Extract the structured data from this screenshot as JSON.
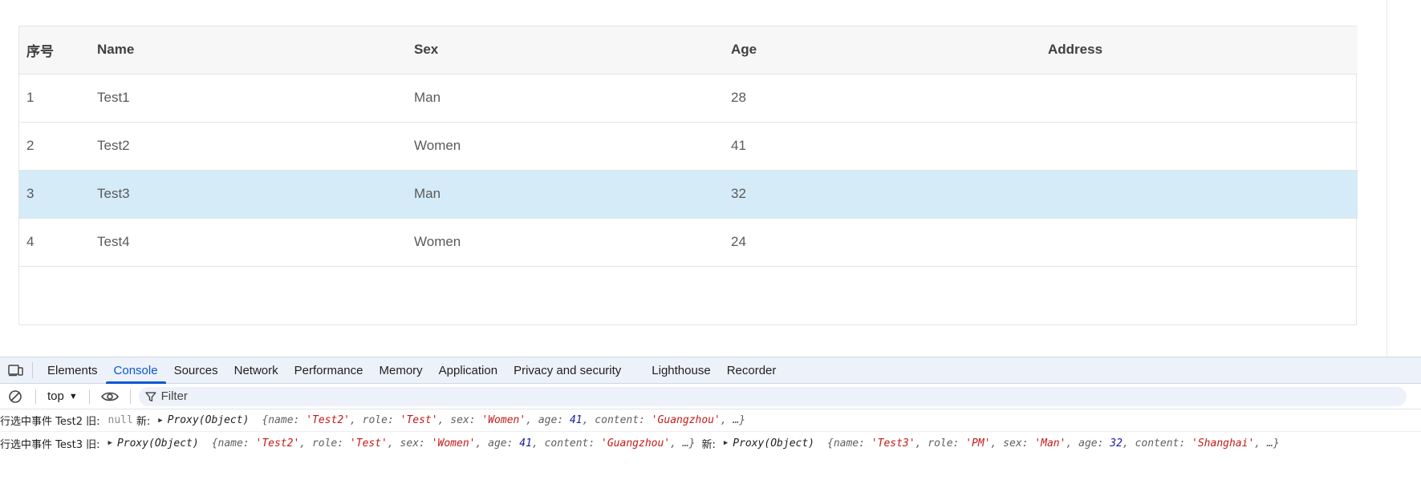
{
  "table": {
    "columns": [
      "序号",
      "Name",
      "Sex",
      "Age",
      "Address"
    ],
    "rows": [
      {
        "index": "1",
        "name": "Test1",
        "sex": "Man",
        "age": "28",
        "address": "",
        "selected": false
      },
      {
        "index": "2",
        "name": "Test2",
        "sex": "Women",
        "age": "41",
        "address": "",
        "selected": false
      },
      {
        "index": "3",
        "name": "Test3",
        "sex": "Man",
        "age": "32",
        "address": "",
        "selected": true
      },
      {
        "index": "4",
        "name": "Test4",
        "sex": "Women",
        "age": "24",
        "address": "",
        "selected": false
      }
    ],
    "selected_color": "#d5ebf7"
  },
  "devtools": {
    "tabs": [
      "Elements",
      "Console",
      "Sources",
      "Network",
      "Performance",
      "Memory",
      "Application",
      "Privacy and security",
      "Lighthouse",
      "Recorder"
    ],
    "active_tab": "Console",
    "toolbar": {
      "context": "top",
      "filter_placeholder": "Filter"
    },
    "console": {
      "line1": {
        "prefix": "行选中事件 Test2 旧:",
        "old": "null",
        "new_label": "新:",
        "new_proxy": "Proxy(Object)",
        "new_obj": {
          "name": "'Test2'",
          "role": "'Test'",
          "sex": "'Women'",
          "age": "41",
          "content": "'Guangzhou'",
          "more": "…}"
        }
      },
      "line2": {
        "prefix": "行选中事件 Test3 旧:",
        "old_proxy": "Proxy(Object)",
        "old_obj": {
          "name": "'Test2'",
          "role": "'Test'",
          "sex": "'Women'",
          "age": "41",
          "content": "'Guangzhou'",
          "more": "…}"
        },
        "new_label": "新:",
        "new_proxy": "Proxy(Object)",
        "new_obj": {
          "name": "'Test3'",
          "role": "'PM'",
          "sex": "'Man'",
          "age": "32",
          "content": "'Shanghai'",
          "more": "…}"
        }
      }
    },
    "accent_color": "#0b57d0"
  }
}
